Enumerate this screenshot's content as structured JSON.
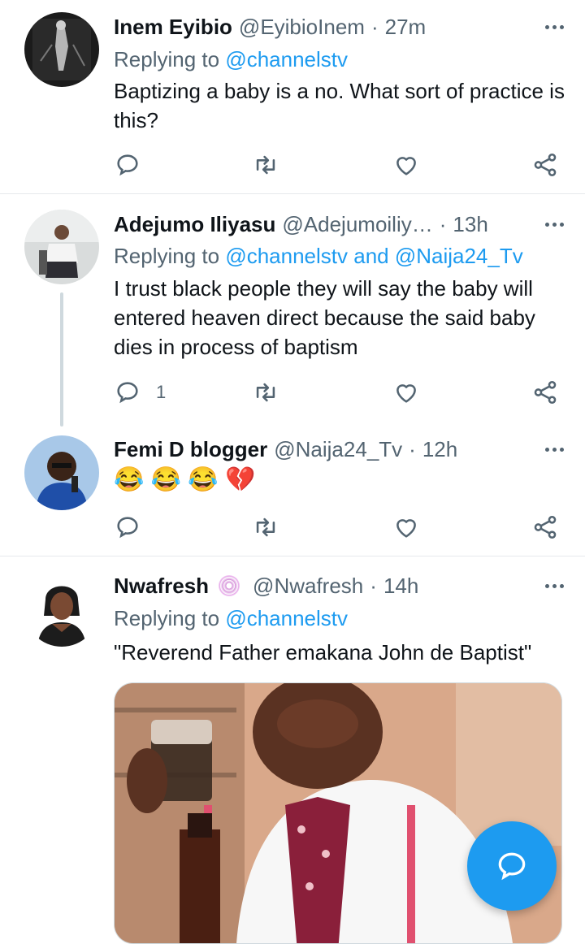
{
  "tweets": [
    {
      "name": "Inem Eyibio",
      "handle": "@EyibioInem",
      "time": "27m",
      "replying_prefix": "Replying to",
      "replying_to": "@channelstv",
      "text": "Baptizing a baby is a no. What sort of practice is this?",
      "reply_count": ""
    },
    {
      "name": "Adejumo Iliyasu",
      "handle": "@Adejumoiliy…",
      "time": "13h",
      "replying_prefix": "Replying to",
      "replying_to": "@channelstv and @Naija24_Tv",
      "text": "I trust black people they will say the baby will entered heaven direct because the said baby dies in process of baptism",
      "reply_count": "1"
    },
    {
      "name": "Femi D blogger",
      "handle": "@Naija24_Tv",
      "time": "12h",
      "emojis": "😂 😂 😂 💔",
      "reply_count": ""
    },
    {
      "name": "Nwafresh",
      "handle": "@Nwafresh",
      "time": "14h",
      "replying_prefix": "Replying to",
      "replying_to": "@channelstv",
      "text": "\"Reverend Father emakana John de Baptist\""
    }
  ],
  "separator": "·",
  "icons": [
    "reply-icon",
    "retweet-icon",
    "like-icon",
    "share-icon",
    "more-icon",
    "compose-reply-icon"
  ],
  "colors": {
    "accent": "#1d9bf0",
    "muted": "#536471",
    "text": "#0f1419"
  }
}
